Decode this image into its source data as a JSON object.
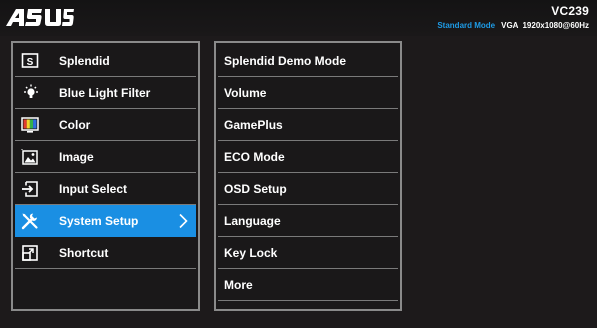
{
  "header": {
    "brand": "ASUS",
    "model": "VC239",
    "mode": "Standard Mode",
    "signal": "VGA",
    "resolution": "1920x1080@60Hz"
  },
  "main_menu": {
    "items": [
      {
        "label": "Splendid",
        "icon": "splendid-icon"
      },
      {
        "label": "Blue Light Filter",
        "icon": "bulb-icon"
      },
      {
        "label": "Color",
        "icon": "color-icon"
      },
      {
        "label": "Image",
        "icon": "image-icon"
      },
      {
        "label": "Input Select",
        "icon": "input-icon"
      },
      {
        "label": "System Setup",
        "icon": "wrench-screwdriver-icon",
        "selected": true
      },
      {
        "label": "Shortcut",
        "icon": "shortcut-icon"
      }
    ]
  },
  "sub_menu": {
    "items": [
      {
        "label": "Splendid Demo Mode"
      },
      {
        "label": "Volume"
      },
      {
        "label": "GamePlus"
      },
      {
        "label": "ECO Mode"
      },
      {
        "label": "OSD Setup"
      },
      {
        "label": "Language"
      },
      {
        "label": "Key Lock"
      },
      {
        "label": "More"
      }
    ]
  },
  "colors": {
    "accent": "#1a8fe3",
    "border": "#8a8a8a",
    "background": "#1d1a1b"
  }
}
